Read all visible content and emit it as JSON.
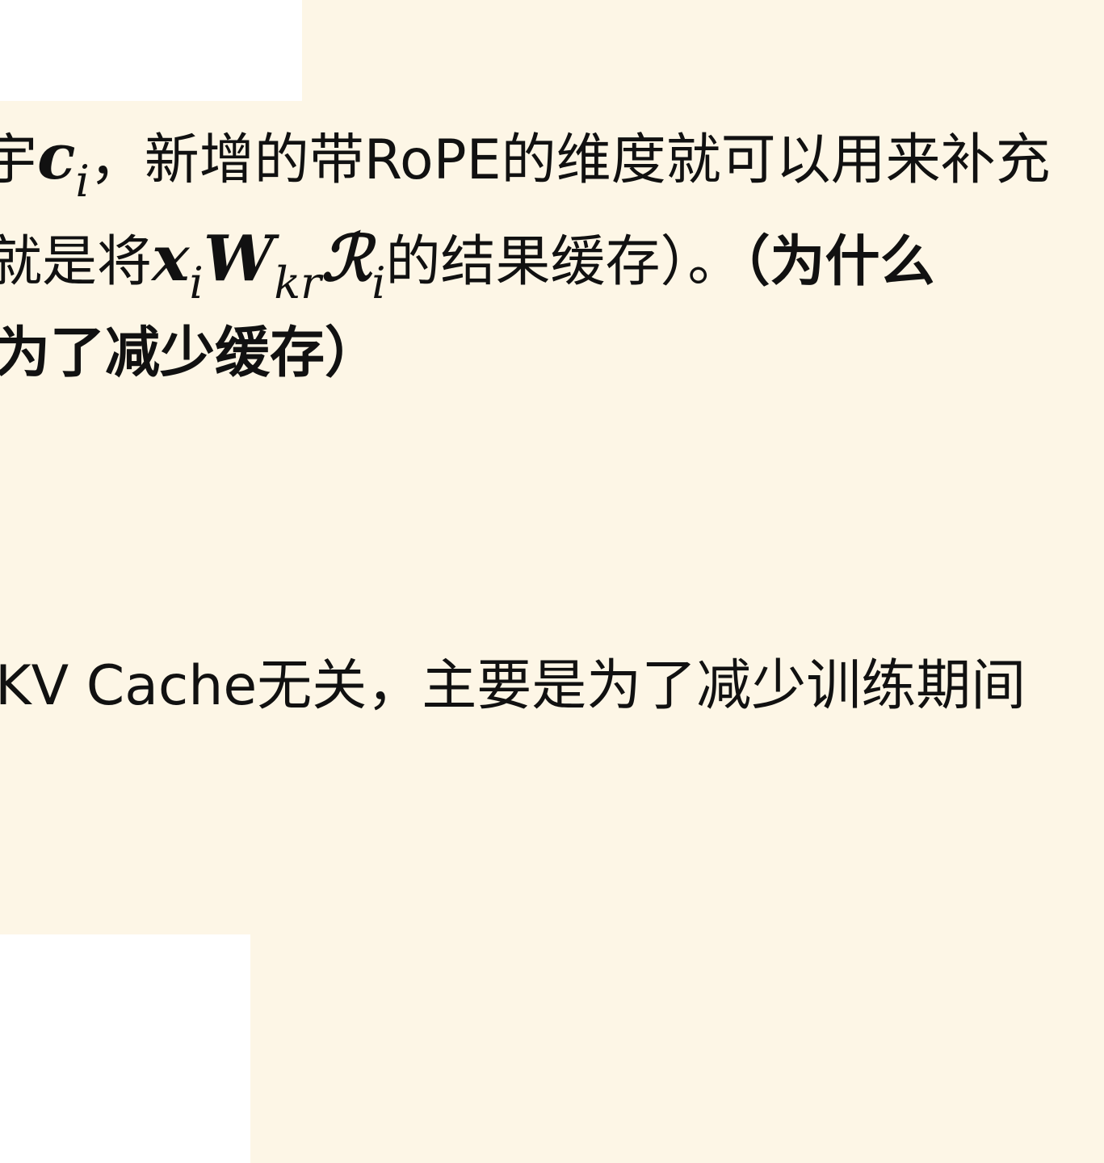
{
  "colors": {
    "background": "#fdf6e6",
    "overlay": "#ffffff",
    "text": "#111111"
  },
  "text": {
    "line1": {
      "prefix": "宇",
      "math_c": "c",
      "math_c_sub": "i",
      "suffix": "，新增的带RoPE的维度就可以用来补充"
    },
    "line2": {
      "prefix": "就是将",
      "math_x": "x",
      "math_x_sub": "i",
      "math_w": "W",
      "math_w_sub": "kr",
      "math_r": "ℛ",
      "math_r_sub": "i",
      "suffix": "的结果缓存）。",
      "bold_suffix": "（为什么"
    },
    "line3": {
      "bold": "为了减少缓存）"
    },
    "line4": {
      "text": "KV Cache无关，主要是为了减少训练期间"
    }
  }
}
